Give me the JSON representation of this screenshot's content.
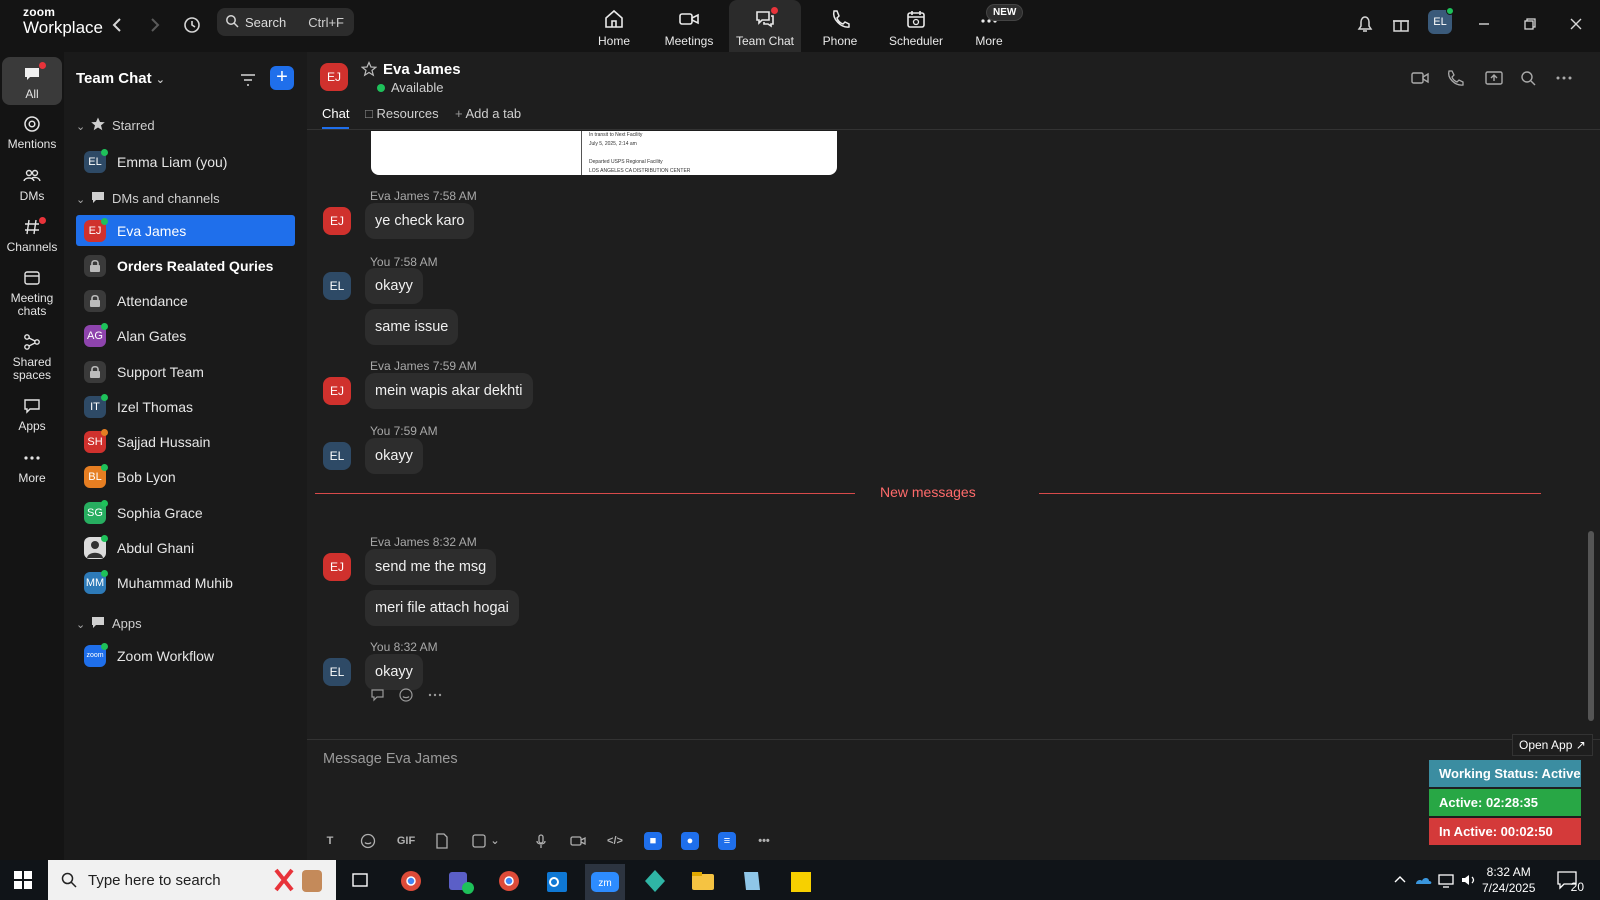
{
  "app": {
    "brand_line1": "zoom",
    "brand_line2": "Workplace"
  },
  "search": {
    "label": "Search",
    "shortcut": "Ctrl+F"
  },
  "nav_tabs": [
    {
      "label": "Home"
    },
    {
      "label": "Meetings"
    },
    {
      "label": "Team Chat"
    },
    {
      "label": "Phone"
    },
    {
      "label": "Scheduler"
    },
    {
      "label": "More"
    }
  ],
  "new_badge": "NEW",
  "user_avatar": "EL",
  "rail": [
    {
      "label": "All"
    },
    {
      "label": "Mentions"
    },
    {
      "label": "DMs"
    },
    {
      "label": "Channels"
    },
    {
      "label": "Meeting chats"
    },
    {
      "label": "Shared spaces"
    },
    {
      "label": "Apps"
    },
    {
      "label": "More"
    }
  ],
  "sidebar": {
    "title": "Team Chat",
    "sections": {
      "starred": "Starred",
      "dms": "DMs and channels",
      "apps": "Apps"
    },
    "starred_items": [
      {
        "initials": "EL",
        "label": "Emma Liam (you)",
        "color": "#2e4a66"
      }
    ],
    "items": [
      {
        "initials": "EJ",
        "label": "Eva James",
        "color": "#d0312d"
      },
      {
        "initials": "",
        "label": "Orders Realated Quries",
        "color": "#3a3a3a"
      },
      {
        "initials": "",
        "label": "Attendance",
        "color": "#3a3a3a"
      },
      {
        "initials": "AG",
        "label": "Alan Gates",
        "color": "#8e44ad"
      },
      {
        "initials": "",
        "label": "Support Team",
        "color": "#3a3a3a"
      },
      {
        "initials": "IT",
        "label": "Izel Thomas",
        "color": "#2e4a66"
      },
      {
        "initials": "SH",
        "label": "Sajjad Hussain",
        "color": "#d0312d"
      },
      {
        "initials": "BL",
        "label": "Bob Lyon",
        "color": "#e67e22"
      },
      {
        "initials": "SG",
        "label": "Sophia Grace",
        "color": "#27ae60"
      },
      {
        "initials": "",
        "label": "Abdul Ghani",
        "color": "#dddddd"
      },
      {
        "initials": "MM",
        "label": "Muhammad Muhib",
        "color": "#2d7ab8"
      }
    ],
    "app_items": [
      {
        "initials": "zoom",
        "label": "Zoom Workflow",
        "color": "#1f6feb"
      }
    ]
  },
  "chat": {
    "contact_initials": "EJ",
    "contact_name": "Eva James",
    "status": "Available",
    "tabs": [
      "Chat",
      "Resources",
      "Add a tab"
    ],
    "compose_placeholder": "Message Eva James",
    "new_messages": "New messages",
    "image_card_lines": [
      "In transit to Next Facility",
      "July 5, 2025, 2:14 am",
      "Departed USPS Regional Facility",
      "LOS ANGELES CA DISTRIBUTION CENTER"
    ],
    "messages": [
      {
        "meta": "Eva James 7:58 AM",
        "initials": "EJ",
        "bubbles": [
          "ye check karo"
        ]
      },
      {
        "meta": "You 7:58 AM",
        "initials": "EL",
        "bubbles": [
          "okayy",
          "same issue"
        ]
      },
      {
        "meta": "Eva James 7:59 AM",
        "initials": "EJ",
        "bubbles": [
          "mein wapis akar dekhti"
        ]
      },
      {
        "meta": "You 7:59 AM",
        "initials": "EL",
        "bubbles": [
          "okayy"
        ]
      },
      {
        "meta": "Eva James 8:32 AM",
        "initials": "EJ",
        "bubbles": [
          "send me the msg",
          "meri file attach hogai"
        ]
      },
      {
        "meta": "You 8:32 AM",
        "initials": "EL",
        "bubbles": [
          "okayy"
        ]
      }
    ]
  },
  "widget": {
    "open_app": "Open App ↗",
    "working_status": "Working Status: Active",
    "active": "Active: 02:28:35",
    "inactive": "In Active: 00:02:50"
  },
  "taskbar": {
    "search_placeholder": "Type here to search",
    "time": "8:32 AM",
    "date": "7/24/2025",
    "notifications": "20"
  },
  "colors": {
    "accent": "#1f6feb",
    "danger": "#d0312d",
    "online": "#1ec15a"
  }
}
